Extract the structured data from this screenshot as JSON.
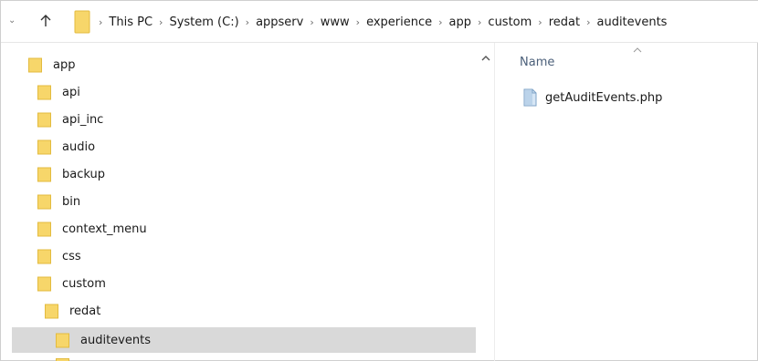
{
  "address_bar": {
    "breadcrumbs": [
      "This PC",
      "System (C:)",
      "appserv",
      "www",
      "experience",
      "app",
      "custom",
      "redat",
      "auditevents"
    ]
  },
  "tree": {
    "items": [
      {
        "label": "app"
      },
      {
        "label": "api"
      },
      {
        "label": "api_inc"
      },
      {
        "label": "audio"
      },
      {
        "label": "backup"
      },
      {
        "label": "bin"
      },
      {
        "label": "context_menu"
      },
      {
        "label": "css"
      },
      {
        "label": "custom"
      },
      {
        "label": "redat"
      },
      {
        "label": "auditevents",
        "selected": true
      }
    ]
  },
  "file_list": {
    "column_name": "Name",
    "files": [
      {
        "name": "getAuditEvents.php"
      }
    ]
  },
  "colors": {
    "folder_fill": "#f7d66a",
    "selection": "#d9d9d9",
    "header_text": "#4c607a"
  }
}
